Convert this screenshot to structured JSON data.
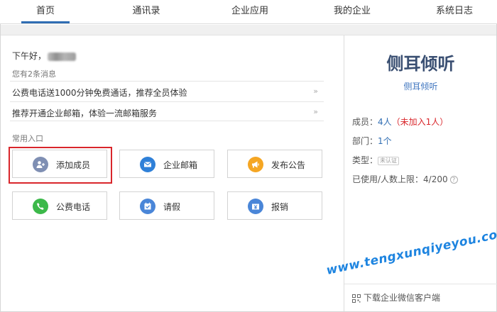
{
  "nav": {
    "items": [
      {
        "label": "首页",
        "active": true
      },
      {
        "label": "通讯录"
      },
      {
        "label": "企业应用"
      },
      {
        "label": "我的企业"
      },
      {
        "label": "系统日志"
      }
    ]
  },
  "greeting": {
    "prefix": "下午好，"
  },
  "messages": {
    "count_text": "您有2条消息",
    "items": [
      {
        "text": "公费电话送1000分钟免费通话，推荐全员体验",
        "arrow": "»"
      },
      {
        "text": "推荐开通企业邮箱，体验一流邮箱服务",
        "arrow": "»"
      }
    ]
  },
  "shortcuts": {
    "title": "常用入口",
    "items": [
      {
        "label": "添加成员",
        "icon": "add-user-icon",
        "color": "#7f8fb3"
      },
      {
        "label": "企业邮箱",
        "icon": "mail-icon",
        "color": "#2f80d8"
      },
      {
        "label": "发布公告",
        "icon": "megaphone-icon",
        "color": "#f5a623"
      },
      {
        "label": "公费电话",
        "icon": "phone-icon",
        "color": "#3cb94a"
      },
      {
        "label": "请假",
        "icon": "calendar-check-icon",
        "color": "#4a86d8"
      },
      {
        "label": "报销",
        "icon": "yen-wallet-icon",
        "color": "#4a86d8"
      }
    ]
  },
  "company": {
    "name": "侧耳倾听",
    "sub": "侧耳倾听",
    "members_label": "成员：",
    "members_value": "4人",
    "members_unjoined": "（未加入1人）",
    "dept_label": "部门：",
    "dept_value": "1个",
    "type_label": "类型：",
    "type_badge": "未认证",
    "limit_label": "已使用/人数上限：",
    "limit_value": "4/200",
    "help": "?",
    "download": "下载企业微信客户端"
  },
  "watermark": "www.tengxunqiyeyou.com"
}
